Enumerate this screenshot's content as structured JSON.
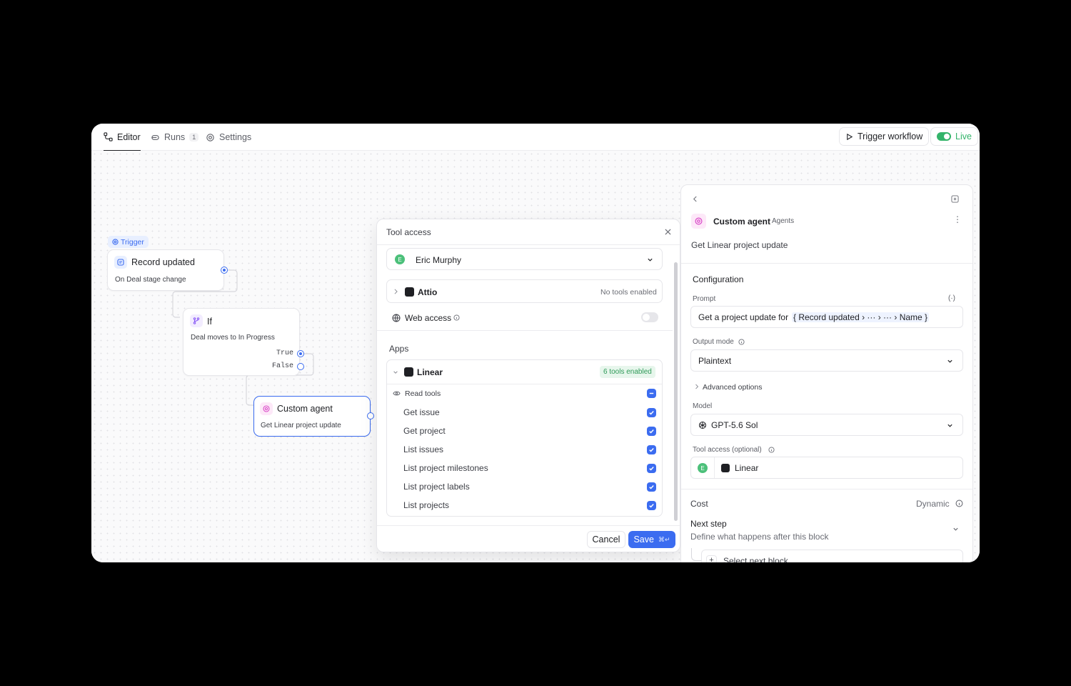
{
  "tabs": [
    {
      "label": "Editor",
      "icon": "workflow-icon",
      "active": true
    },
    {
      "label": "Runs",
      "icon": "runs-icon",
      "count": "1"
    },
    {
      "label": "Settings",
      "icon": "gear-icon"
    }
  ],
  "toolbar": {
    "trigger_label": "Trigger workflow",
    "live_label": "Live"
  },
  "nodes": {
    "trigger_badge": "Trigger",
    "record": {
      "title": "Record updated",
      "sub": "On Deal stage change"
    },
    "if": {
      "title": "If",
      "sub": "Deal moves to In Progress",
      "true_label": "True",
      "false_label": "False"
    },
    "agent": {
      "title": "Custom agent",
      "sub": "Get Linear project update"
    }
  },
  "modal": {
    "title": "Tool access",
    "user": {
      "initial": "E",
      "name": "Eric Murphy"
    },
    "attio": {
      "name": "Attio",
      "status": "No tools enabled"
    },
    "web_access": "Web access",
    "apps_heading": "Apps",
    "linear": {
      "name": "Linear",
      "status": "6 tools enabled"
    },
    "read_tools": "Read tools",
    "tools": [
      "Get issue",
      "Get project",
      "List issues",
      "List project milestones",
      "List project labels",
      "List projects"
    ],
    "cancel": "Cancel",
    "save": "Save",
    "save_shortcut": "⌘↵"
  },
  "panel": {
    "title": "Custom agent",
    "category": "Agents",
    "description": "Get Linear project update",
    "config_heading": "Configuration",
    "prompt_label": "Prompt",
    "prompt_prefix": "Get a project update for",
    "prompt_tag": "{ Record updated › ··· › ··· › Name }",
    "output_label": "Output mode",
    "output_value": "Plaintext",
    "advanced": "Advanced options",
    "model_label": "Model",
    "model_value": "GPT-5.6 Sol",
    "tool_label": "Tool access (optional)",
    "tool_initial": "E",
    "tool_value": "Linear",
    "cost_label": "Cost",
    "cost_value": "Dynamic",
    "next_title": "Next step",
    "next_sub": "Define what happens after this block",
    "select_next": "Select next block"
  },
  "colors": {
    "accent": "#3b6cf0",
    "live": "#34b46a",
    "agent": "#d94ac8",
    "if": "#8b5cf6"
  }
}
